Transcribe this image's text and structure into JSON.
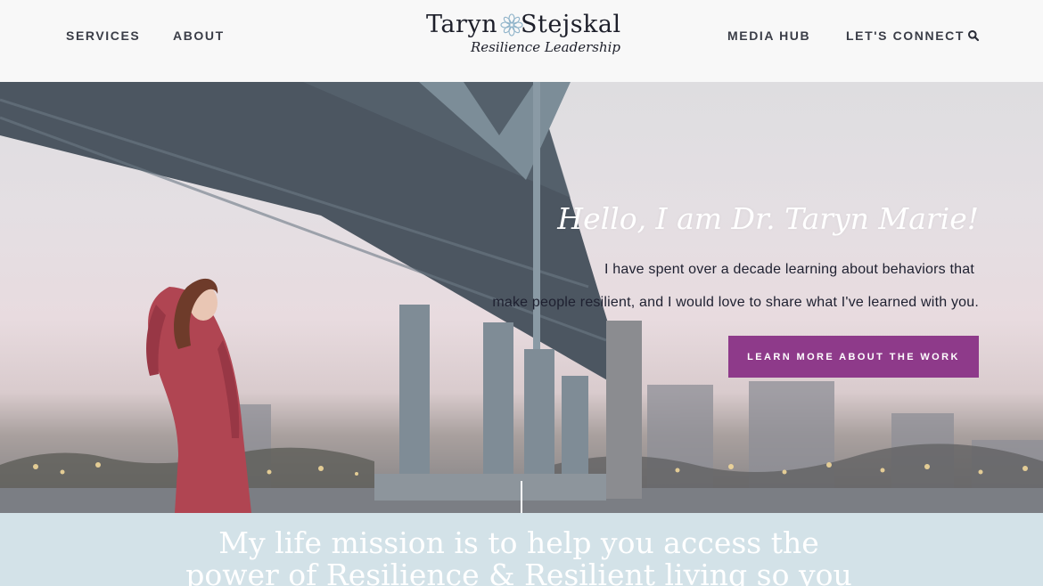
{
  "header": {
    "nav_left": [
      "SERVICES",
      "ABOUT"
    ],
    "nav_right": [
      "MEDIA HUB",
      "LET'S CONNECT"
    ],
    "logo": {
      "first": "Taryn",
      "last": "Stejskal",
      "tagline": "Resilience Leadership"
    },
    "search_icon": "search-icon"
  },
  "hero": {
    "title": "Hello, I am Dr. Taryn Marie!",
    "line1": "I have spent over a decade learning about behaviors that",
    "line2": "make people resilient, and I would love to share what I've learned with you.",
    "cta_label": "LEARN MORE ABOUT THE WORK"
  },
  "mission": {
    "line1": "My life mission is to help you access the",
    "line2": "power of Resilience & Resilient living so you"
  },
  "colors": {
    "accent": "#8e3a8a",
    "mission_band": "#d3e2e8",
    "nav_text": "#3a3d47"
  }
}
